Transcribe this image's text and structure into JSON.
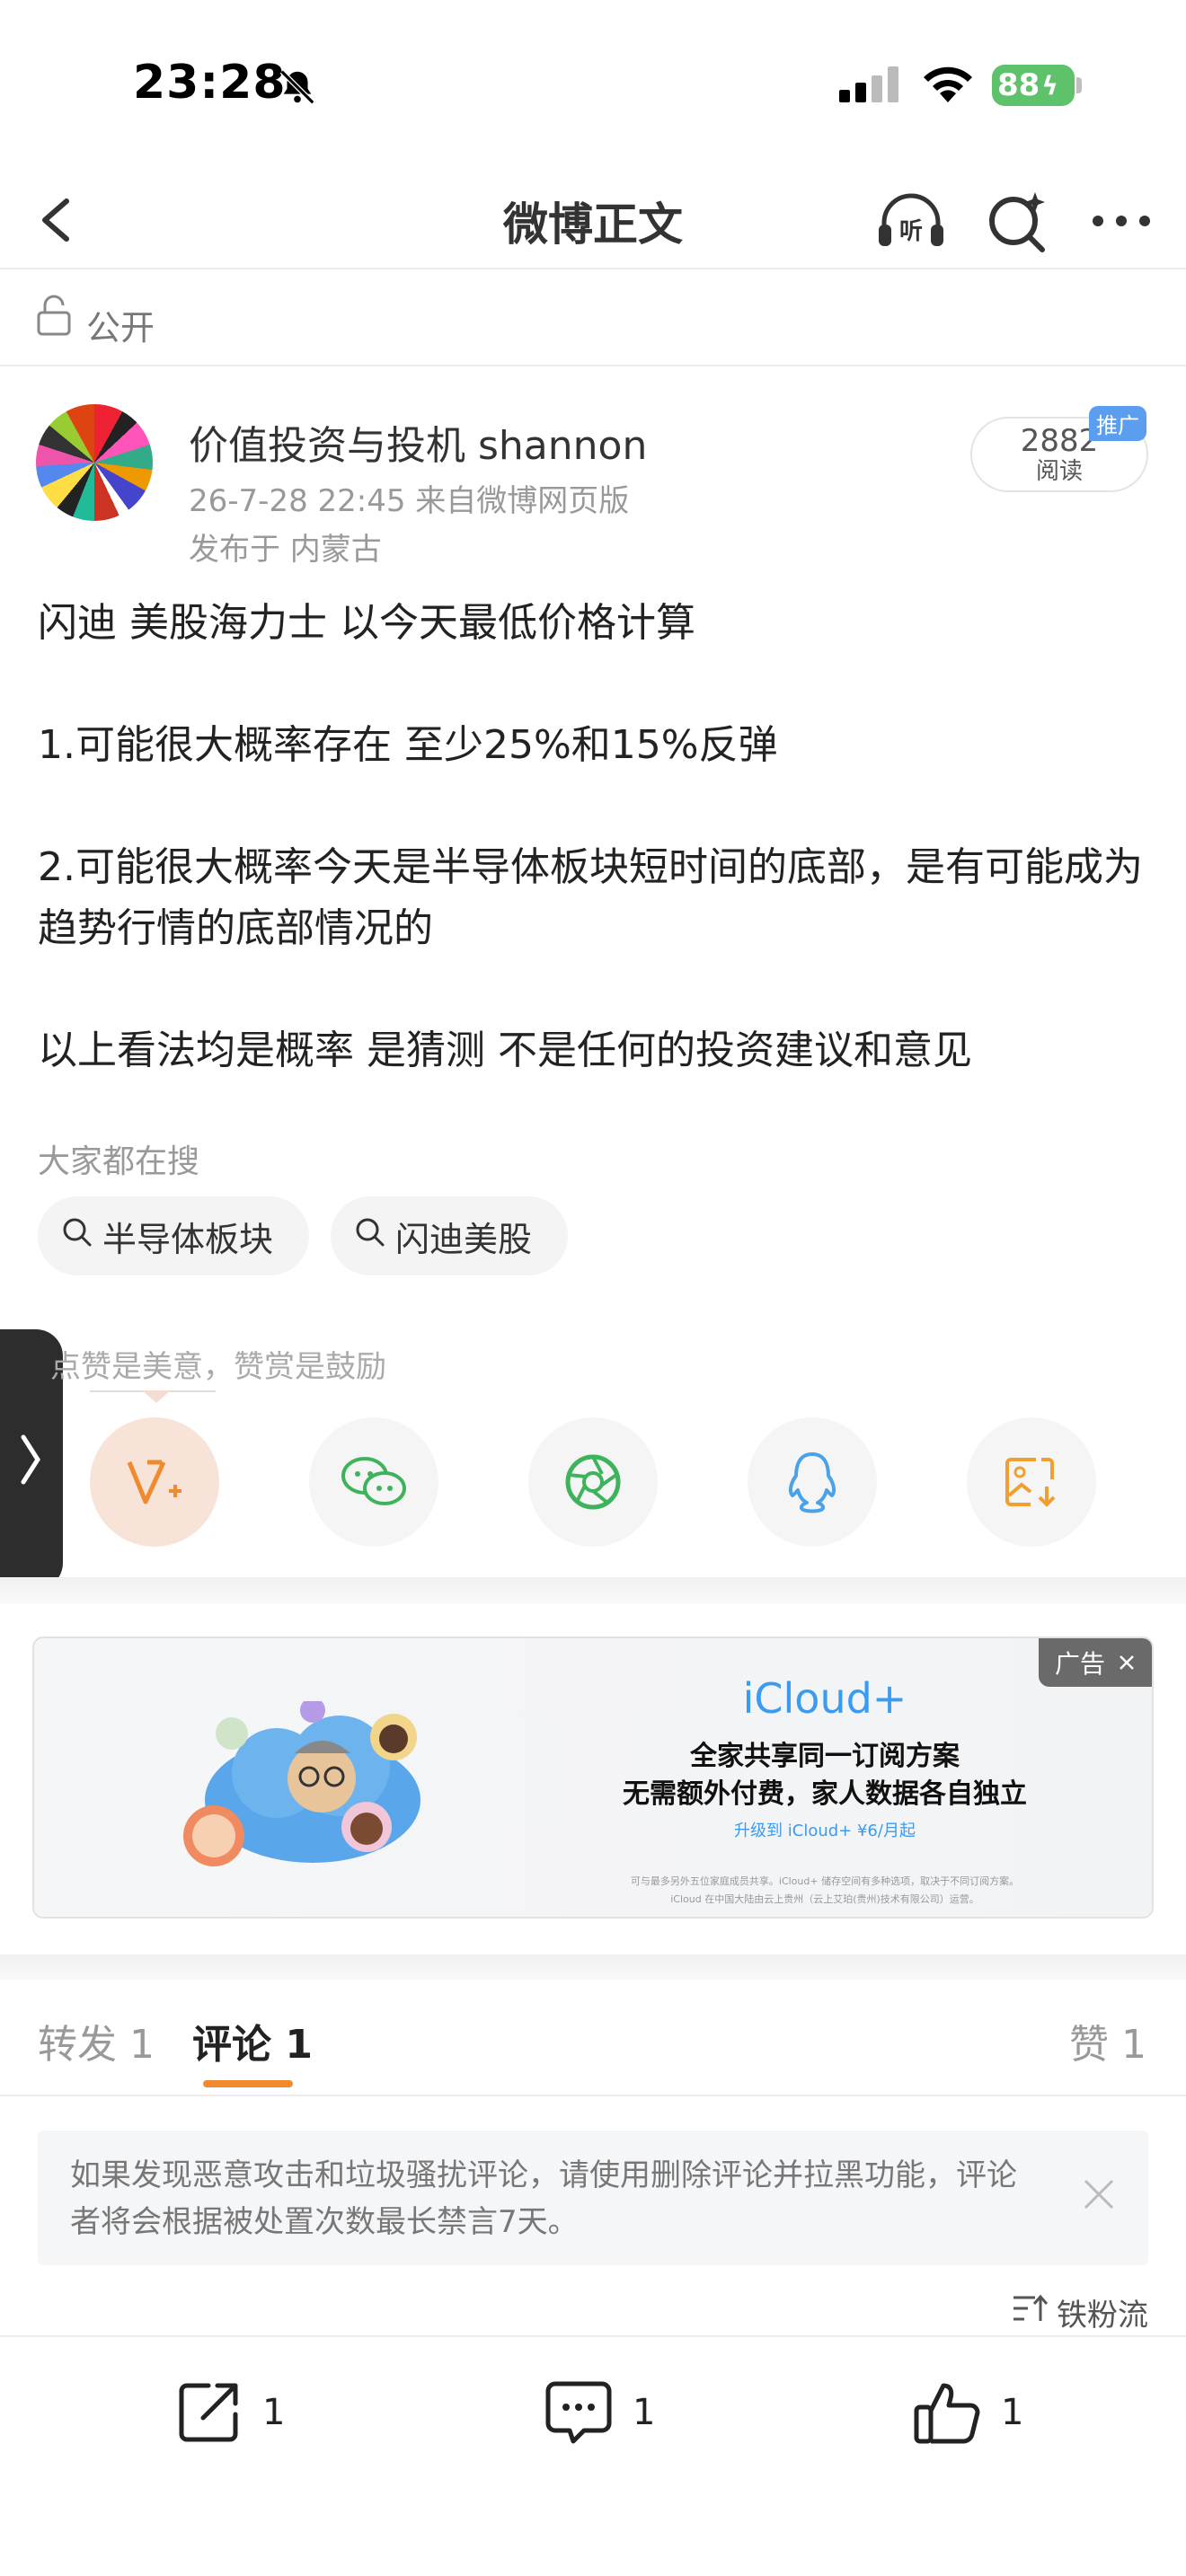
{
  "status_bar": {
    "time": "23:28",
    "battery": "88"
  },
  "navbar": {
    "title": "微博正文"
  },
  "visibility": {
    "label": "公开"
  },
  "post": {
    "author": "价值投资与投机 shannon",
    "meta": "26-7-28 22:45  来自微博网页版",
    "location": "发布于 内蒙古",
    "read_count": "2882",
    "read_label": "阅读",
    "promo_tag": "推广",
    "paragraphs": [
      "闪迪 美股海力士 以今天最低价格计算",
      "1.可能很大概率存在 至少25%和15%反弹",
      "2.可能很大概率今天是半导体板块短时间的底部，是有可能成为趋势行情的底部情况的",
      "以上看法均是概率 是猜测 不是任何的投资建议和意见"
    ]
  },
  "trending": {
    "title": "大家都在搜",
    "chips": [
      "半导体板块",
      "闪迪美股"
    ]
  },
  "reward": {
    "text": "点赞是美意，赞赏是鼓励"
  },
  "ad": {
    "tag": "广告",
    "headline": "iCloud+",
    "line1": "全家共享同一订阅方案",
    "line2": "无需额外付费，家人数据各自独立",
    "cta": "升级到 iCloud+ ¥6/月起",
    "fine1": "可与最多另外五位家庭成员共享。iCloud+ 储存空间有多种选项，取决于不同订阅方案。",
    "fine2": "iCloud 在中国大陆由云上贵州（云上艾珀(贵州)技术有限公司）运营。"
  },
  "tabs": {
    "repost": "转发 1",
    "comment": "评论 1",
    "like": "赞 1"
  },
  "notice": {
    "text": "如果发现恶意攻击和垃圾骚扰评论，请使用删除评论并拉黑功能，评论者将会根据被处置次数最长禁言7天。"
  },
  "sort": {
    "label": "铁粉流"
  },
  "bottom_bar": {
    "repost_count": "1",
    "comment_count": "1",
    "like_count": "1"
  },
  "colors": {
    "accent": "#f08a2e",
    "link_blue": "#3a9bf0",
    "battery_green": "#5ec26a"
  }
}
